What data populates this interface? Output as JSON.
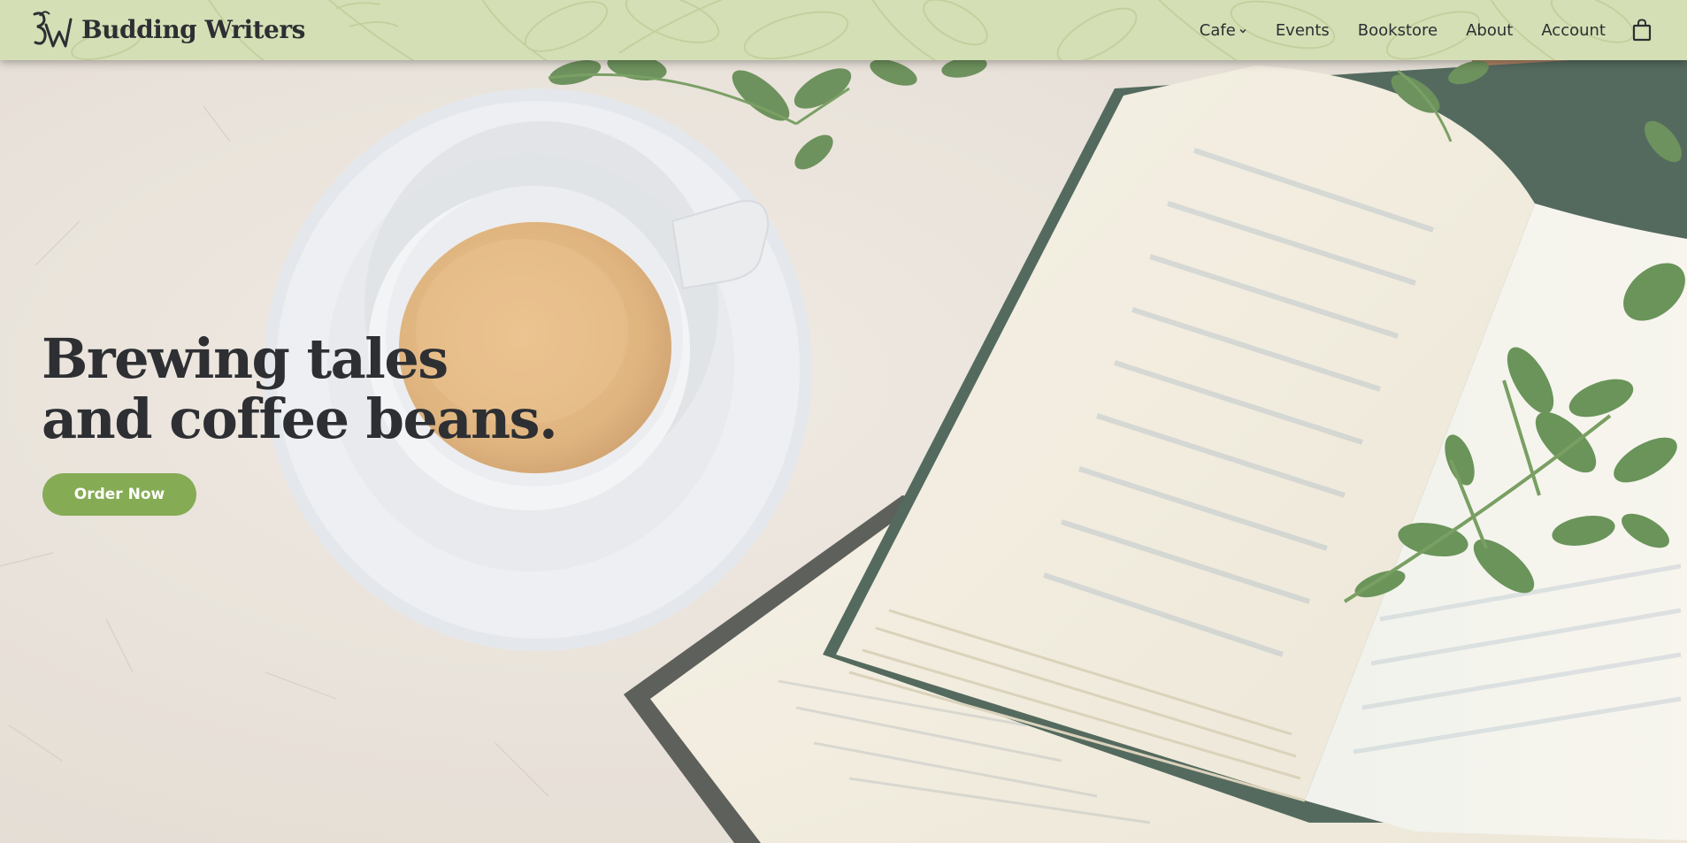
{
  "brand": {
    "name": "Budding Writers",
    "monogram": "BW"
  },
  "nav": {
    "items": [
      {
        "label": "Cafe",
        "has_dropdown": true
      },
      {
        "label": "Events"
      },
      {
        "label": "Bookstore"
      },
      {
        "label": "About"
      },
      {
        "label": "Account"
      }
    ],
    "cart_icon": "shopping-bag-icon"
  },
  "hero": {
    "headline_line1": "Brewing tales",
    "headline_line2": "and coffee beans.",
    "cta_label": "Order Now",
    "image_description_icon": "coffee-cup-and-open-book-photo"
  },
  "colors": {
    "header_bg": "#d5dfb5",
    "accent_green": "#86ab55",
    "text_dark": "#2d2f33",
    "background_stone": "#e6dfd6"
  }
}
